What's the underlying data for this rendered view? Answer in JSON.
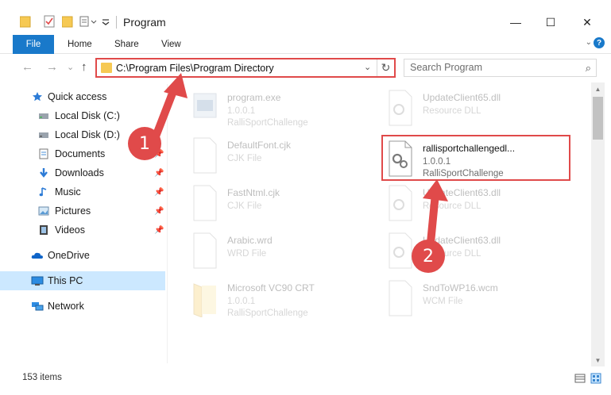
{
  "window": {
    "title": "Program",
    "minimize_glyph": "—",
    "maximize_glyph": "☐",
    "close_glyph": "✕"
  },
  "ribbon": {
    "file_tab": "File",
    "tabs": [
      "Home",
      "Share",
      "View"
    ],
    "help_glyph": "?",
    "expand_glyph": "⌄"
  },
  "navigation": {
    "back_glyph": "←",
    "forward_glyph": "→",
    "recent_glyph": "⌄",
    "up_glyph": "↑"
  },
  "address_bar": {
    "path": "C:\\Program Files\\Program Directory",
    "dropdown_glyph": "⌄",
    "refresh_glyph": "↻"
  },
  "search": {
    "placeholder": "Search Program",
    "icon_glyph": "⌕"
  },
  "sidebar": {
    "items": [
      {
        "label": "Quick access",
        "icon": "star-icon",
        "pinned": false
      },
      {
        "label": "Local Disk (C:)",
        "icon": "drive-icon",
        "pinned": false
      },
      {
        "label": "Local Disk (D:)",
        "icon": "drive-icon",
        "pinned": false
      },
      {
        "label": "Documents",
        "icon": "documents-icon",
        "pinned": true
      },
      {
        "label": "Downloads",
        "icon": "download-icon",
        "pinned": true
      },
      {
        "label": "Music",
        "icon": "music-icon",
        "pinned": true
      },
      {
        "label": "Pictures",
        "icon": "pictures-icon",
        "pinned": true
      },
      {
        "label": "Videos",
        "icon": "videos-icon",
        "pinned": true
      },
      {
        "label": "OneDrive",
        "icon": "cloud-icon",
        "pinned": false
      },
      {
        "label": "This PC",
        "icon": "computer-icon",
        "pinned": false,
        "selected": true
      },
      {
        "label": "Network",
        "icon": "network-icon",
        "pinned": false
      }
    ],
    "pin_glyph": "📌"
  },
  "files": [
    {
      "name": "program.exe",
      "line2": "1.0.0.1",
      "line3": "RalliSportChallenge",
      "faded": true,
      "icon": "exe-icon"
    },
    {
      "name": "UpdateClient65.dll",
      "line2": "Resource DLL",
      "line3": "",
      "faded": true,
      "icon": "dll-icon"
    },
    {
      "name": "DefaultFont.cjk",
      "line2": "CJK File",
      "line3": "",
      "faded": true,
      "icon": "file-icon"
    },
    {
      "name": "rallisportchallengedl...",
      "line2": "1.0.0.1",
      "line3": "RalliSportChallenge",
      "faded": false,
      "icon": "dll-icon"
    },
    {
      "name": "FastNtml.cjk",
      "line2": "CJK File",
      "line3": "",
      "faded": true,
      "icon": "file-icon"
    },
    {
      "name": "UpdateClient63.dll",
      "line2": "Resource DLL",
      "line3": "",
      "faded": true,
      "icon": "dll-icon"
    },
    {
      "name": "Arabic.wrd",
      "line2": "WRD File",
      "line3": "",
      "faded": true,
      "icon": "file-icon"
    },
    {
      "name": "UpdateClient63.dll",
      "line2": "Resource DLL",
      "line3": "",
      "faded": true,
      "icon": "dll-icon"
    },
    {
      "name": "Microsoft VC90 CRT",
      "line2": "1.0.0.1",
      "line3": "RalliSportChallenge",
      "faded": true,
      "icon": "folder-icon"
    },
    {
      "name": "SndToWP16.wcm",
      "line2": "WCM File",
      "line3": "",
      "faded": true,
      "icon": "file-icon"
    }
  ],
  "status_bar": {
    "item_count": "153 items"
  },
  "callouts": [
    "1",
    "2"
  ],
  "colors": {
    "accent": "#1979ca",
    "highlight": "#e04a4a",
    "selected_bg": "#cce8ff",
    "folder": "#f6c953"
  }
}
